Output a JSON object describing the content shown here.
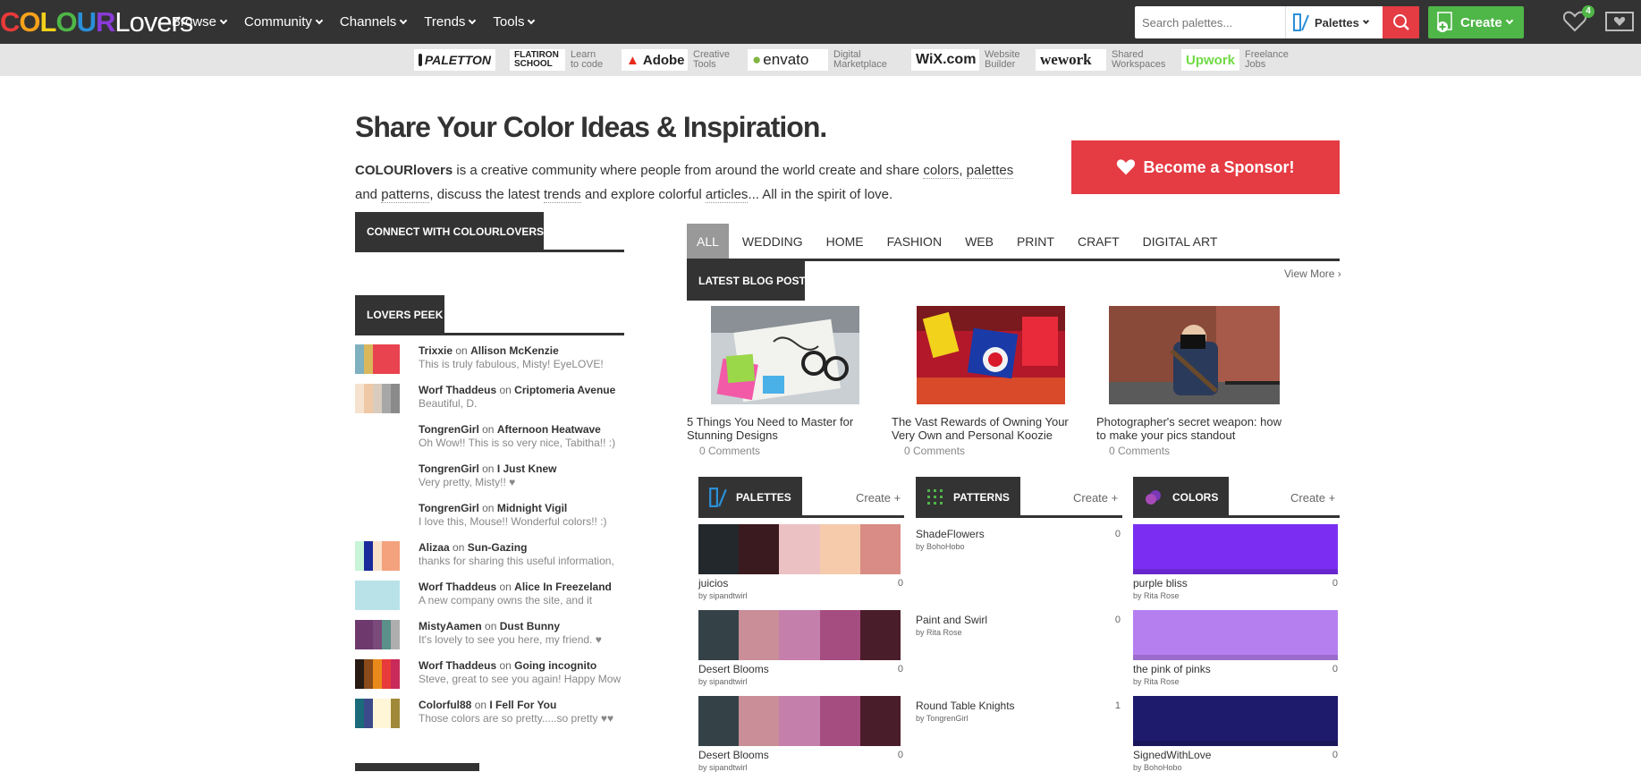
{
  "header": {
    "logo_colour": "COLOUR",
    "logo_lovers": "Lovers",
    "nav": [
      {
        "label": "Browse"
      },
      {
        "label": "Community"
      },
      {
        "label": "Channels"
      },
      {
        "label": "Trends"
      },
      {
        "label": "Tools"
      }
    ],
    "search_placeholder": "Search palettes...",
    "search_type": "Palettes",
    "create_label": "Create",
    "favorites_badge": "4"
  },
  "sponsors": [
    {
      "name": "PALETTON",
      "text": ""
    },
    {
      "name": "FLATIRON SCHOOL",
      "text": "Learn\nto code"
    },
    {
      "name": "Adobe",
      "text": "Creative\nTools"
    },
    {
      "name": "envato",
      "text": "Digital\nMarketplace"
    },
    {
      "name": "WiX.com",
      "text": "Website\nBuilder"
    },
    {
      "name": "wework",
      "text": "Shared\nWorkspaces"
    },
    {
      "name": "Upwork",
      "text": "Freelance\nJobs"
    }
  ],
  "hero": {
    "title": "Share Your Color Ideas & Inspiration.",
    "brand": "COLOURlovers",
    "t1": " is a creative community where people from around the world create and share ",
    "colors": "colors",
    "comma1": ", ",
    "palettes": "palettes",
    "t2": " and ",
    "patterns": "patterns",
    "t3": ", discuss the latest ",
    "trends": "trends",
    "t4": " and explore colorful ",
    "articles": "articles",
    "t5": "... All in the spirit of love.",
    "sponsor_button": "Become a Sponsor!"
  },
  "connect": {
    "label": "CONNECT WITH COLOURLOVERS"
  },
  "peek": {
    "label": "LOVERS PEEK",
    "on": "on",
    "items": [
      {
        "user": "Trixxie",
        "target": "Allison McKenzie",
        "comment": "This is truly fabulous, Misty! EyeLOVE!",
        "colors": [
          "#7fb0c0",
          "#d9b85c",
          "#e8434f",
          "#e8434f",
          "#e8434f"
        ]
      },
      {
        "user": "Worf Thaddeus",
        "target": "Criptomeria Avenue",
        "comment": "Beautiful, D.",
        "colors": [
          "#f6e3cf",
          "#efc9a6",
          "#d9cbbd",
          "#a7a7a7",
          "#8a8a8a"
        ]
      },
      {
        "user": "TongrenGirl",
        "target": "Afternoon Heatwave",
        "comment": "Oh Wow!! This is so very nice, Tabitha!! :)",
        "colors": []
      },
      {
        "user": "TongrenGirl",
        "target": "I Just Knew",
        "comment": "Very pretty, Misty!! ♥",
        "colors": []
      },
      {
        "user": "TongrenGirl",
        "target": "Midnight Vigil",
        "comment": "I love this, Mouse!! Wonderful colors!! :)",
        "colors": []
      },
      {
        "user": "Alizaa",
        "target": "Sun-Gazing",
        "comment": "thanks for sharing this useful information,",
        "colors": [
          "#c8f5d8",
          "#1a2a9a",
          "#fbe0c8",
          "#f4a27e",
          "#f4a27e"
        ]
      },
      {
        "user": "Worf Thaddeus",
        "target": "Alice In Freezeland",
        "comment": "A new company owns the site, and it",
        "colors": [
          "#b8e2e8",
          "#b8e2e8",
          "#b8e2e8",
          "#b8e2e8",
          "#b8e2e8"
        ]
      },
      {
        "user": "MistyAamen",
        "target": "Dust Bunny",
        "comment": "It's lovely to see you here, my friend. ♥",
        "colors": [
          "#6e3a6e",
          "#6e3a6e",
          "#7a4a7a",
          "#5a8f8a",
          "#aeaeae"
        ]
      },
      {
        "user": "Worf Thaddeus",
        "target": "Going incognito",
        "comment": "Steve, great to see you again! Happy Mow",
        "colors": [
          "#2a1a14",
          "#8a4a1a",
          "#e88a1a",
          "#e83a3a",
          "#c82a5a"
        ]
      },
      {
        "user": "Colorful88",
        "target": "I Fell For You",
        "comment": "Those colors are so pretty.....so pretty ♥♥",
        "colors": [
          "#1a6a7a",
          "#3a4a8a",
          "#fff6d8",
          "#fff6d8",
          "#a08a3a"
        ]
      }
    ]
  },
  "tabs": [
    "ALL",
    "WEDDING",
    "HOME",
    "FASHION",
    "WEB",
    "PRINT",
    "CRAFT",
    "DIGITAL ART"
  ],
  "blog": {
    "label": "LATEST BLOG POSTS",
    "view_more": "View More ›",
    "posts": [
      {
        "title": "5 Things You Need to Master for Stunning Designs",
        "comments": "0 Comments"
      },
      {
        "title": "The Vast Rewards of Owning Your Very Own and Personal Koozie",
        "comments": "0 Comments"
      },
      {
        "title": "Photographer's secret weapon: how to make your pics standout",
        "comments": "0 Comments"
      }
    ]
  },
  "palettes": {
    "label": "PALETTES",
    "create": "Create +",
    "items": [
      {
        "name": "juicios",
        "by": "by sipandtwirl",
        "count": "0",
        "colors": [
          "#23282c",
          "#3a1a1e",
          "#ecc1c3",
          "#f5cbac",
          "#d98b85"
        ]
      },
      {
        "name": "Desert Blooms",
        "by": "by sipandtwirl",
        "count": "0",
        "colors": [
          "#344248",
          "#c98e97",
          "#c57fab",
          "#a54d80",
          "#4a1d2a"
        ]
      },
      {
        "name": "Desert Blooms",
        "by": "by sipandtwirl",
        "count": "0",
        "colors": [
          "#344248",
          "#c98e97",
          "#c57fab",
          "#a54d80",
          "#4a1d2a"
        ]
      }
    ]
  },
  "patterns": {
    "label": "PATTERNS",
    "create": "Create +",
    "items": [
      {
        "name": "ShadeFlowers",
        "by": "by BohoHobo",
        "count": "0"
      },
      {
        "name": "Paint and Swirl",
        "by": "by Rita Rose",
        "count": "0"
      },
      {
        "name": "Round Table Knights",
        "by": "by TongrenGirl",
        "count": "1"
      }
    ]
  },
  "colors": {
    "label": "COLORS",
    "create": "Create +",
    "items": [
      {
        "name": "purple bliss",
        "by": "by Rita Rose",
        "count": "0",
        "hex": "#7b2ef2"
      },
      {
        "name": "the pink of pinks",
        "by": "by Rita Rose",
        "count": "0",
        "hex": "#b67ff0"
      },
      {
        "name": "SignedWithLove",
        "by": "by BohoHobo",
        "count": "0",
        "hex": "#1e1a6c"
      }
    ]
  },
  "theme": {
    "accent_red": "#e53b43",
    "accent_green": "#4fb648",
    "dark": "#333333"
  }
}
